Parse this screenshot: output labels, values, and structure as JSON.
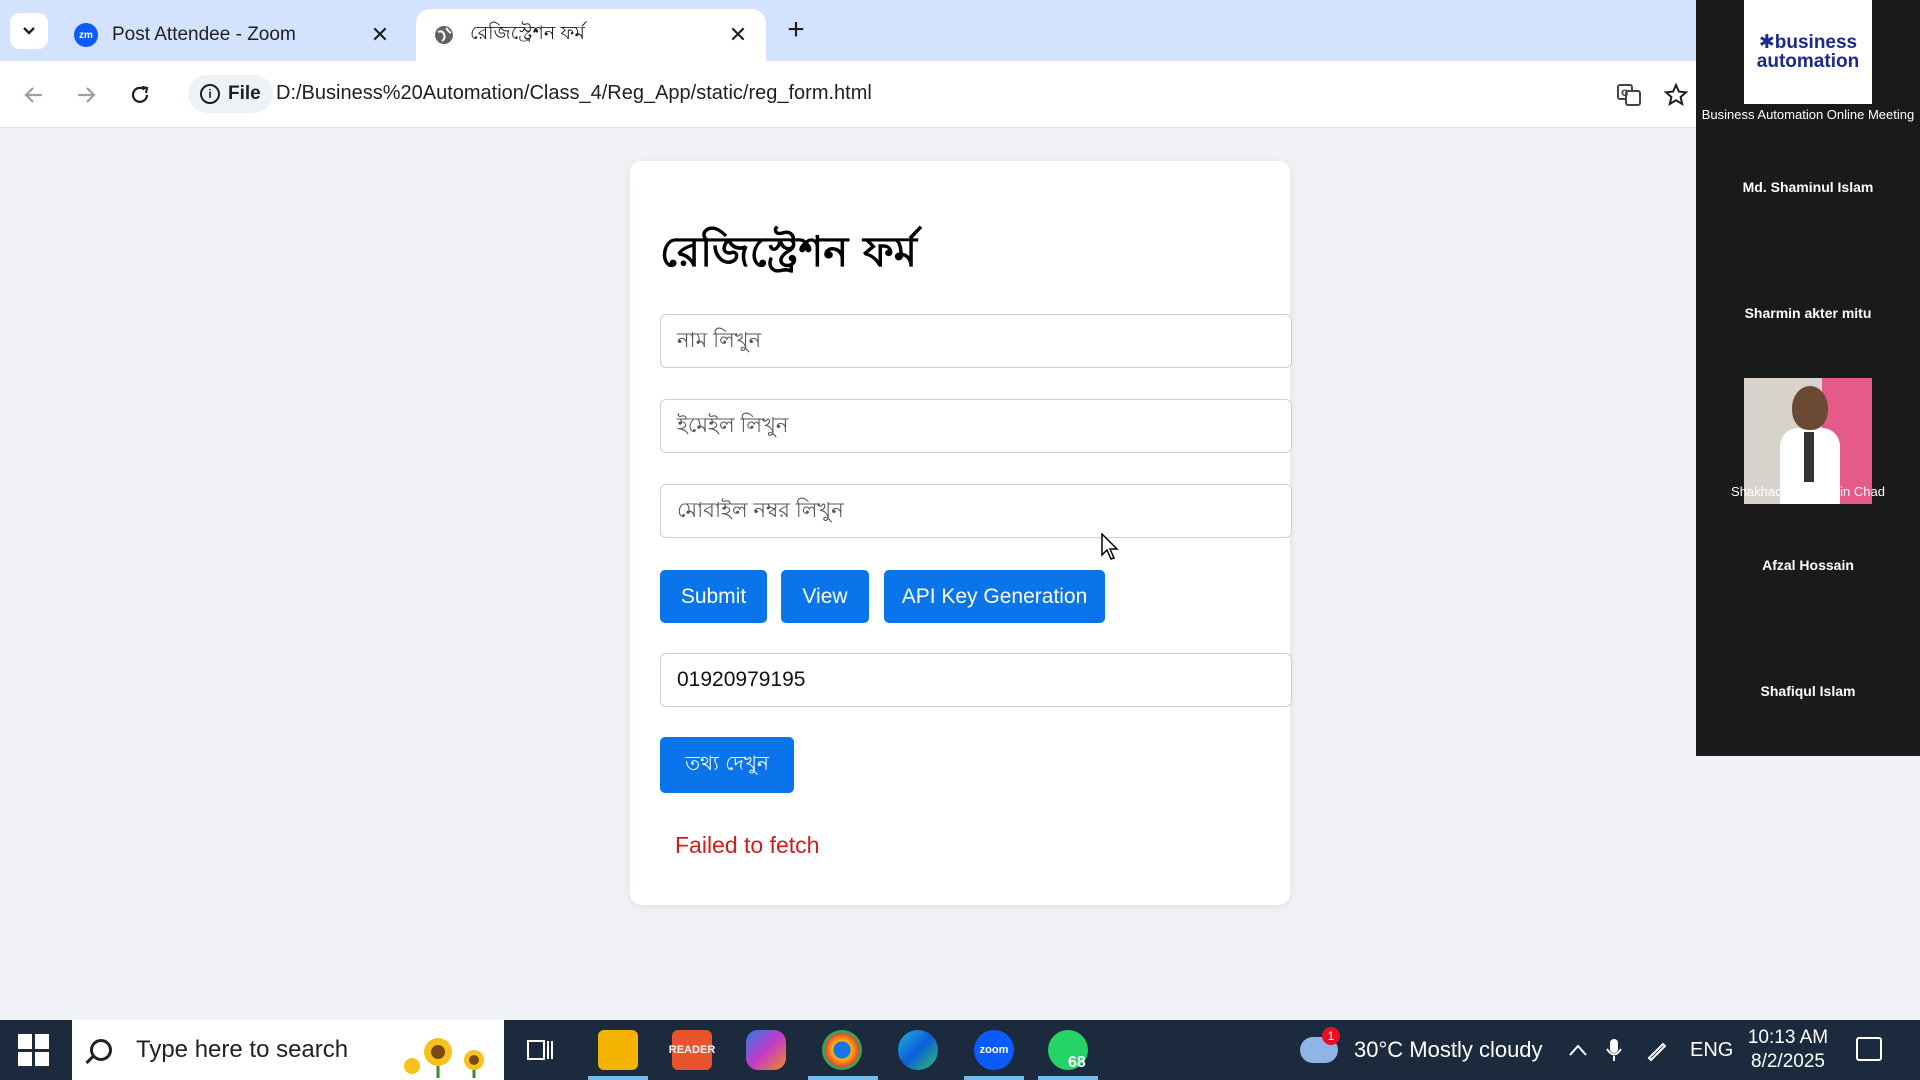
{
  "browser": {
    "tabs": [
      {
        "title": "Post Attendee - Zoom",
        "favicon": "zoom-icon",
        "favicon_text": "zm",
        "active": false
      },
      {
        "title": "রেজিস্ট্রেশন ফর্ম",
        "favicon": "globe-icon",
        "active": true
      }
    ],
    "address_chip": "File",
    "url": "D:/Business%20Automation/Class_4/Reg_App/static/reg_form.html"
  },
  "form": {
    "title": "রেজিস্ট্রেশন ফর্ম",
    "name_placeholder": "নাম লিখুন",
    "email_placeholder": "ইমেইল লিখুন",
    "mobile_placeholder": "মোবাইল নম্বর লিখুন",
    "buttons": {
      "submit": "Submit",
      "view": "View",
      "api_key": "API Key Generation"
    },
    "lookup_value": "01920979195",
    "show_info_button": "তথ্য দেখুন",
    "error_message": "Failed to fetch",
    "colors": {
      "button": "#0a74ea",
      "error": "#d61a1a"
    }
  },
  "zoom_panel": {
    "logo_line1": "✱business",
    "logo_line2": "automation",
    "meeting_name": "Business Automation Online Meeting",
    "participants": [
      "Md. Shaminul Islam",
      "Sharmin akter mitu",
      "Shakhaoyat Hossain Chad",
      "Afzal Hossain",
      "Shafiqul Islam"
    ]
  },
  "taskbar": {
    "search_placeholder": "Type here to search",
    "reader_label": "READER",
    "zoom_label": "zoom",
    "whatsapp_badge": "68",
    "weather_alert": "1",
    "weather": "30°C  Mostly cloudy",
    "language": "ENG",
    "time": "10:13 AM",
    "date": "8/2/2025"
  }
}
